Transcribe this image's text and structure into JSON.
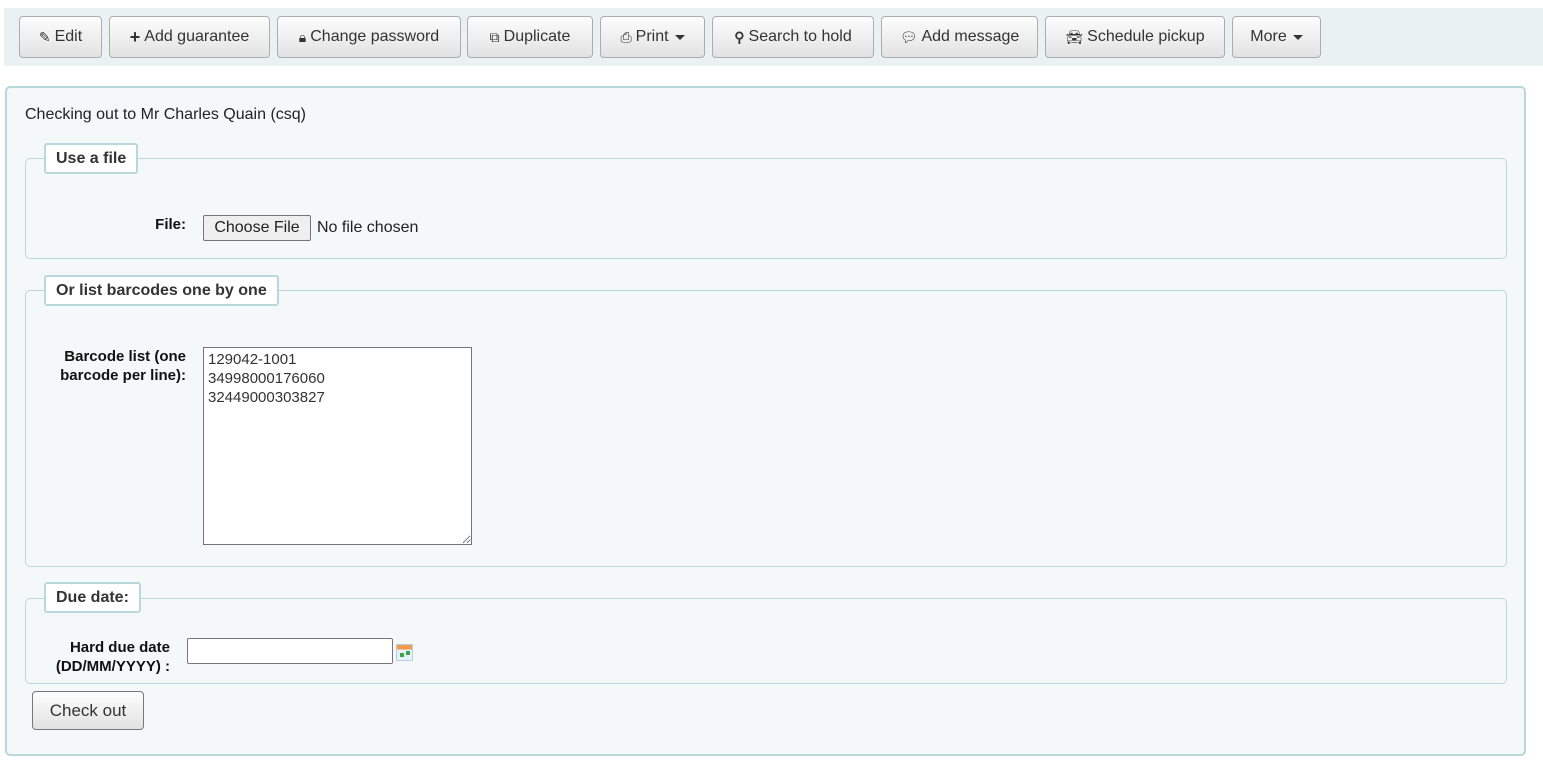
{
  "toolbar": {
    "buttons": [
      {
        "label": "Edit",
        "icon": "pencil-icon"
      },
      {
        "label": "Add guarantee",
        "icon": "plus-icon"
      },
      {
        "label": "Change password",
        "icon": "lock-icon"
      },
      {
        "label": "Duplicate",
        "icon": "copy-icon"
      },
      {
        "label": "Print",
        "icon": "print-icon"
      },
      {
        "label": "Search to hold",
        "icon": "search-icon"
      },
      {
        "label": "Add message",
        "icon": "comment-icon"
      },
      {
        "label": "Schedule pickup",
        "icon": "car-icon"
      },
      {
        "label": "More",
        "icon": "caret-down-icon"
      }
    ]
  },
  "main": {
    "title": "Checking out to Mr Charles Quain (csq)",
    "file_section": {
      "legend": "Use a file",
      "label": "File:",
      "button": "Choose File",
      "status": "No file chosen"
    },
    "barcode_section": {
      "legend": "Or list barcodes one by one",
      "label_line1": "Barcode list (one",
      "label_line2": "barcode per line):",
      "value": "129042-1001\n34998000176060\n32449000303827"
    },
    "due_section": {
      "legend": "Due date:",
      "label_line1": "Hard due date",
      "label_line2": "(DD/MM/YYYY) :",
      "value": ""
    },
    "checkout_button": "Check out"
  }
}
